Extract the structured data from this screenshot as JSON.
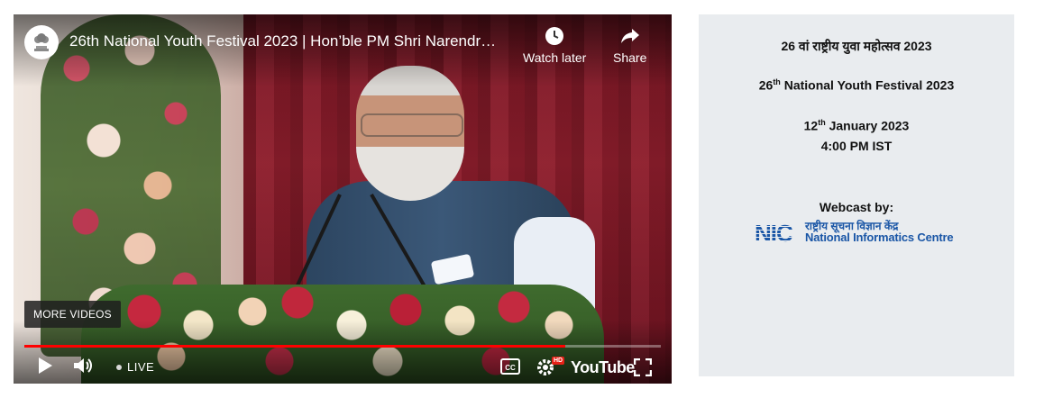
{
  "player": {
    "title": "26th National Youth Festival 2023 | Hon’ble PM Shri Narendr…",
    "watch_later_label": "Watch later",
    "share_label": "Share",
    "more_videos_label": "MORE VIDEOS",
    "live_label": "LIVE",
    "youtube_label": "YouTube",
    "hd_badge": "HD",
    "progress": 0.85,
    "progress_color": "#ff0000",
    "icons": {
      "channel": "state-emblem-icon",
      "watch_later": "clock-icon",
      "share": "share-arrow-icon",
      "play": "play-icon",
      "volume": "volume-icon",
      "captions": "cc-icon",
      "settings": "gear-icon",
      "fullscreen": "fullscreen-icon"
    }
  },
  "info": {
    "hindi_title": "26 वां राष्ट्रीय युवा महोत्सव 2023",
    "event_ordinal_number": "26",
    "event_ordinal_suffix": "th",
    "event_name": " National Youth Festival 2023",
    "date_day": "12",
    "date_suffix": "th",
    "date_rest": " January 2023",
    "time": "4:00 PM IST",
    "webcast_label": "Webcast by:",
    "nic_mark": "NIC",
    "nic_hindi": "राष्ट्रीय सूचना विज्ञान केंद्र",
    "nic_english": "National Informatics Centre",
    "nic_color": "#1a56a6",
    "panel_background": "#e9ecef"
  }
}
